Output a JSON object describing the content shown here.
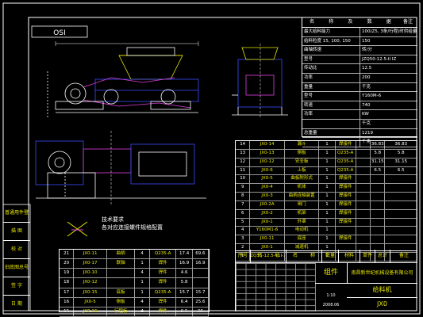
{
  "frame": {
    "bg": "#000000",
    "line": "#ffffff"
  },
  "colors": {
    "white": "#ffffff",
    "yellow": "#e8e800",
    "cyan": "#00d8d8",
    "blue": "#3a4cff",
    "magenta": "#e040e0",
    "red": "#e03030",
    "green": "#30c030"
  },
  "stamp_tl": "OSI",
  "left_strip": [
    "普通用件登记",
    "描 图",
    "校 对",
    "旧底图总号",
    "签 字",
    "日 期"
  ],
  "tech_note": {
    "title": "技术要求",
    "line": "各对应连接螺件规格配置"
  },
  "spec_table": {
    "headers": [
      "名",
      "称",
      "及",
      "数",
      "据",
      "备注"
    ],
    "rows": [
      [
        "最大给料能力",
        "100(Z5, 3条/行程)时供给量"
      ],
      [
        "给料粒度 15, 100, 150",
        "150"
      ],
      [
        "曲轴转速",
        "转/分"
      ],
      [
        "型号",
        "JZQ50-12.5-II IZ"
      ],
      [
        "传动比",
        "12.5"
      ],
      [
        "功率",
        "200"
      ],
      [
        "重量",
        "千克"
      ],
      [
        "型号",
        "Y160M-6"
      ],
      [
        "转速",
        "740"
      ],
      [
        "功率",
        "KW"
      ],
      [
        "",
        "千克"
      ],
      [
        "总重量",
        "1219"
      ],
      [
        "",
        "千克"
      ]
    ]
  },
  "parts_right": [
    [
      "14",
      "JX0-14",
      "漏斗",
      "1",
      "焊接件",
      "",
      "36.83",
      "36.83"
    ],
    [
      "13",
      "JX0-13",
      "侧板",
      "1",
      "Q235-A",
      "",
      "5.8",
      "5.8"
    ],
    [
      "12",
      "JX0-12",
      "安全板",
      "1",
      "Q235-A",
      "",
      "31.15",
      "31.15"
    ],
    [
      "11",
      "JX0-6",
      "上板",
      "1",
      "Q235-A",
      "",
      "6.5",
      "6.5"
    ],
    [
      "10",
      "JX0-5",
      "曲板附形式",
      "1",
      "焊接件",
      "",
      "",
      ""
    ],
    [
      "9",
      "JX0-4",
      "机体",
      "1",
      "焊接件",
      "",
      "",
      ""
    ],
    [
      "8",
      "JX0-3",
      "曲柄连轴装置",
      "1",
      "焊接件",
      "",
      "",
      ""
    ],
    [
      "7",
      "JX0-2A",
      "闸门",
      "1",
      "焊接件",
      "",
      "",
      ""
    ],
    [
      "6",
      "JX0-2",
      "机架",
      "1",
      "焊接件",
      "",
      "",
      ""
    ],
    [
      "5",
      "JX0-1",
      "外罩",
      "1",
      "焊接件",
      "",
      "",
      ""
    ],
    [
      "4",
      "Y160M1-6",
      "电动机",
      "1",
      "",
      "",
      "",
      ""
    ],
    [
      "3",
      "JX0-11",
      "底座",
      "1",
      "焊接件",
      "",
      "",
      ""
    ],
    [
      "2",
      "JX0-1",
      "减速机",
      "1",
      "",
      "",
      "",
      ""
    ],
    [
      "1",
      "ZQ35-12.5-11I-Z",
      "",
      "1",
      "",
      "",
      "",
      ""
    ]
  ],
  "parts_right_header": [
    "序号",
    "代",
    "号",
    "名",
    "称",
    "数量",
    "材料",
    "单件",
    "总计",
    "备注"
  ],
  "parts_left": [
    [
      "21",
      "JX0-11",
      "曲柄",
      "4",
      "Q235-A",
      "17.4",
      "69.6"
    ],
    [
      "20",
      "JX0-17",
      "联轴",
      "1",
      "焊件",
      "16.9",
      "16.9"
    ],
    [
      "19",
      "JX0-10",
      "",
      "4",
      "焊件",
      "4.6",
      ""
    ],
    [
      "18",
      "JX0-12",
      "",
      "1",
      "焊件",
      "5.8",
      ""
    ],
    [
      "17",
      "JX0-15",
      "底板",
      "1",
      "Q235-A",
      "15.7",
      "15.7"
    ],
    [
      "16",
      "JX0-5",
      "侧板",
      "4",
      "焊件",
      "6.4",
      "25.6"
    ],
    [
      "15",
      "JX0-16",
      "行程板",
      "4",
      "焊件",
      "6.5",
      "26"
    ]
  ],
  "title_block": {
    "assembly": "总装",
    "group": "组件",
    "company": "南昌新世纪机械设备有限公司",
    "drawing_name": "给料机",
    "code": "JX0",
    "scale": "1:10",
    "sheet": "共 张 第 张",
    "date": "2008.06"
  }
}
